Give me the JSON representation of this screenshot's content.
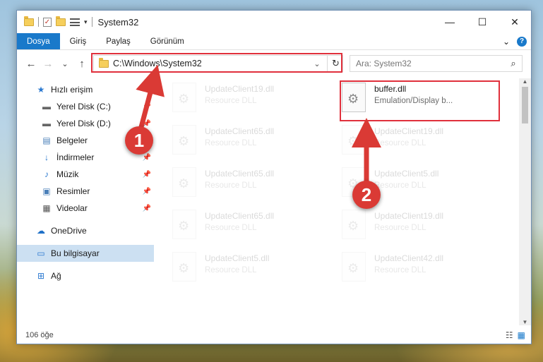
{
  "window": {
    "title": "System32",
    "controls": {
      "minimize": "—",
      "maximize": "☐",
      "close": "✕"
    }
  },
  "quick_access": {
    "dropdown": "▾"
  },
  "ribbon": {
    "tabs": [
      {
        "label": "Dosya",
        "active": true
      },
      {
        "label": "Giriş"
      },
      {
        "label": "Paylaş"
      },
      {
        "label": "Görünüm"
      }
    ],
    "expand": "⌄",
    "help": "?"
  },
  "nav": {
    "back": "←",
    "forward": "→",
    "recent": "⌄",
    "up": "↑"
  },
  "address": {
    "path": "C:\\Windows\\System32",
    "dropdown": "⌄",
    "refresh": "↻"
  },
  "search": {
    "placeholder": "Ara: System32",
    "icon": "⌕"
  },
  "sidebar": {
    "items": [
      {
        "label": "Hızlı erişim",
        "icon": "★"
      },
      {
        "label": "Yerel Disk (C:)",
        "icon": "▬",
        "pinned": true
      },
      {
        "label": "Yerel Disk (D:)",
        "icon": "▬",
        "pinned": true
      },
      {
        "label": "Belgeler",
        "icon": "▤",
        "pinned": true
      },
      {
        "label": "İndirmeler",
        "icon": "↓",
        "pinned": true
      },
      {
        "label": "Müzik",
        "icon": "♪",
        "pinned": true
      },
      {
        "label": "Resimler",
        "icon": "▣",
        "pinned": true
      },
      {
        "label": "Videolar",
        "icon": "▦",
        "pinned": true
      },
      {
        "label": "OneDrive",
        "icon": "☁"
      },
      {
        "label": "Bu bilgisayar",
        "icon": "▭",
        "selected": true
      },
      {
        "label": "Ağ",
        "icon": "⊞"
      }
    ],
    "pin_glyph": "📌"
  },
  "files": {
    "highlighted": {
      "name": "buffer.dll",
      "desc": "Emulation/Display b..."
    },
    "ghost": [
      {
        "name": "UpdateClient19.dll",
        "desc": "Resource DLL"
      },
      {
        "name": "UpdateClient65.dll",
        "desc": "Resource DLL"
      },
      {
        "name": "UpdateClient65.dll",
        "desc": "Resource DLL"
      },
      {
        "name": "UpdateClient65.dll",
        "desc": "Resource DLL"
      },
      {
        "name": "UpdateClient5.dll",
        "desc": "Resource DLL"
      },
      {
        "name": "UpdateClient19.dll",
        "desc": "Resource DLL"
      },
      {
        "name": "UpdateClient5.dll",
        "desc": "Resource DLL"
      },
      {
        "name": "UpdateClient19.dll",
        "desc": "Resource DLL"
      },
      {
        "name": "UpdateClient42.dll",
        "desc": "Resource DLL"
      }
    ]
  },
  "scrollbar": {
    "up": "▲",
    "down": "▼"
  },
  "status": {
    "count": "106 öğe",
    "view_details": "☷",
    "view_tiles": "▦"
  },
  "annotations": {
    "callouts": [
      "1",
      "2"
    ],
    "color": "#e0303c"
  }
}
